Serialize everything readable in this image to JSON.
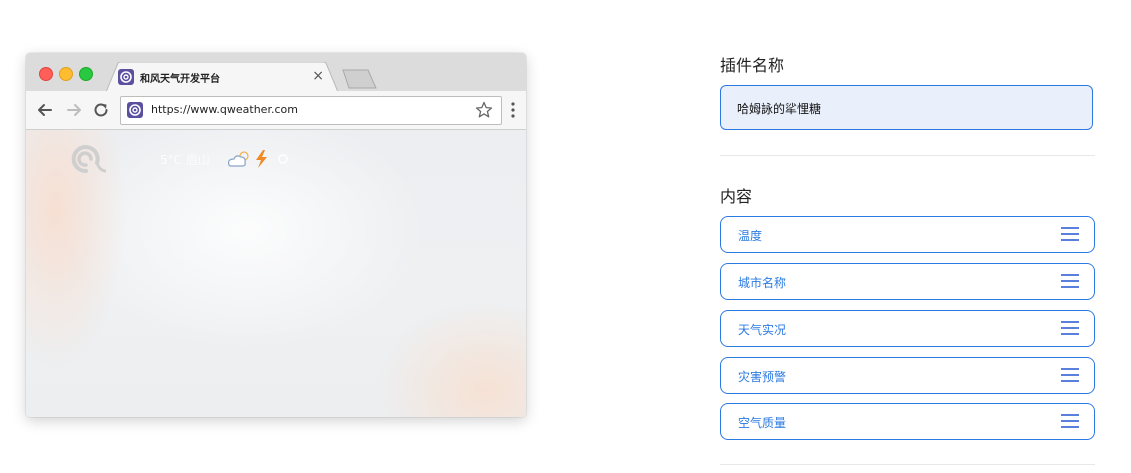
{
  "browser": {
    "tab_title": "和风天气开发平台",
    "close_glyph": "×",
    "url": "https://www.qweather.com",
    "weather_preview": "5°C 眉山"
  },
  "plugin": {
    "name_heading": "插件名称",
    "name_value": "哈姆詠的㸺悝糖",
    "content_heading": "内容",
    "items": [
      {
        "label": "温度"
      },
      {
        "label": "城市名称"
      },
      {
        "label": "天气实况"
      },
      {
        "label": "灾害预警"
      },
      {
        "label": "空气质量"
      }
    ]
  },
  "icons": {
    "browser": [
      "back-arrow-icon",
      "forward-arrow-icon",
      "reload-icon",
      "star-icon",
      "menu-dots-icon"
    ],
    "weather": [
      "qweather-logo-icon",
      "cloudy-icon",
      "lightning-icon"
    ],
    "items": "drag-handle-icon"
  },
  "colors": {
    "accent": "#2a7ae2",
    "input_bg": "#e9effb",
    "favicon": "#5b4fa0",
    "lightning": "#f08a24"
  }
}
